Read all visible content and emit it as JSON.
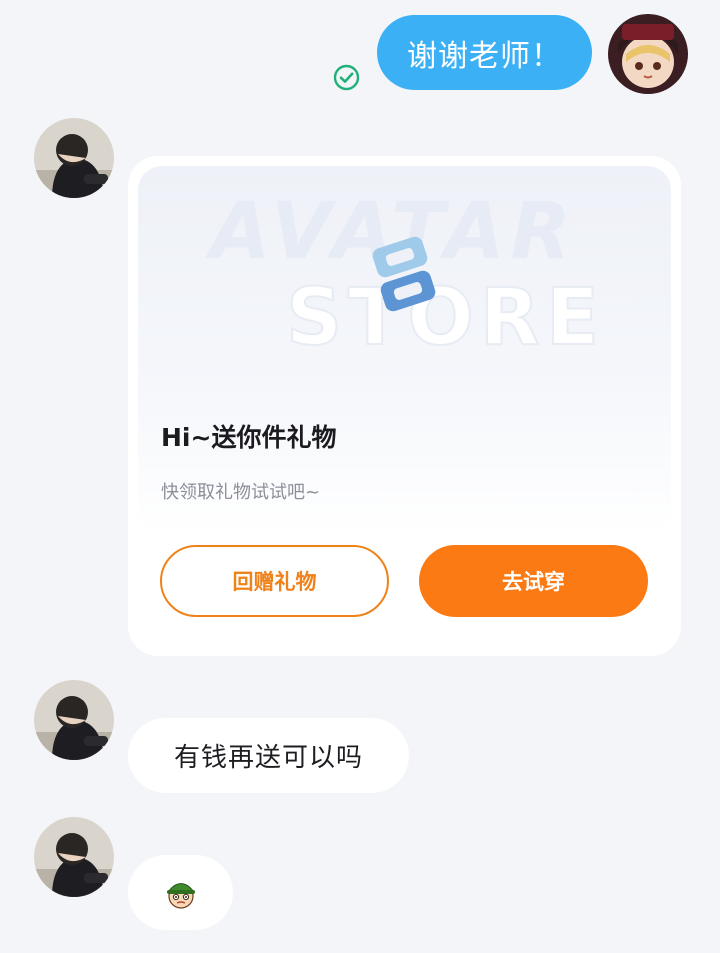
{
  "messages": {
    "outgoing": {
      "text": "谢谢老师！",
      "status_icon": "read-check-icon"
    },
    "gift_card": {
      "banner": {
        "watermark_line1": "AVATAR",
        "watermark_line2": "STORE",
        "logo_icon": "avatar-store-logo-icon"
      },
      "title": "Hi~送你件礼物",
      "subtitle": "快领取礼物试试吧~",
      "return_gift_label": "回赠礼物",
      "try_on_label": "去试穿"
    },
    "incoming_text": "有钱再送可以吗",
    "incoming_sticker": "face-emoji-with-green-hat-icon"
  },
  "colors": {
    "page_bg": "#f4f5f9",
    "outgoing_bubble": "#3bb0f5",
    "accent_orange": "#fb7a14",
    "read_check": "#22b07a"
  }
}
